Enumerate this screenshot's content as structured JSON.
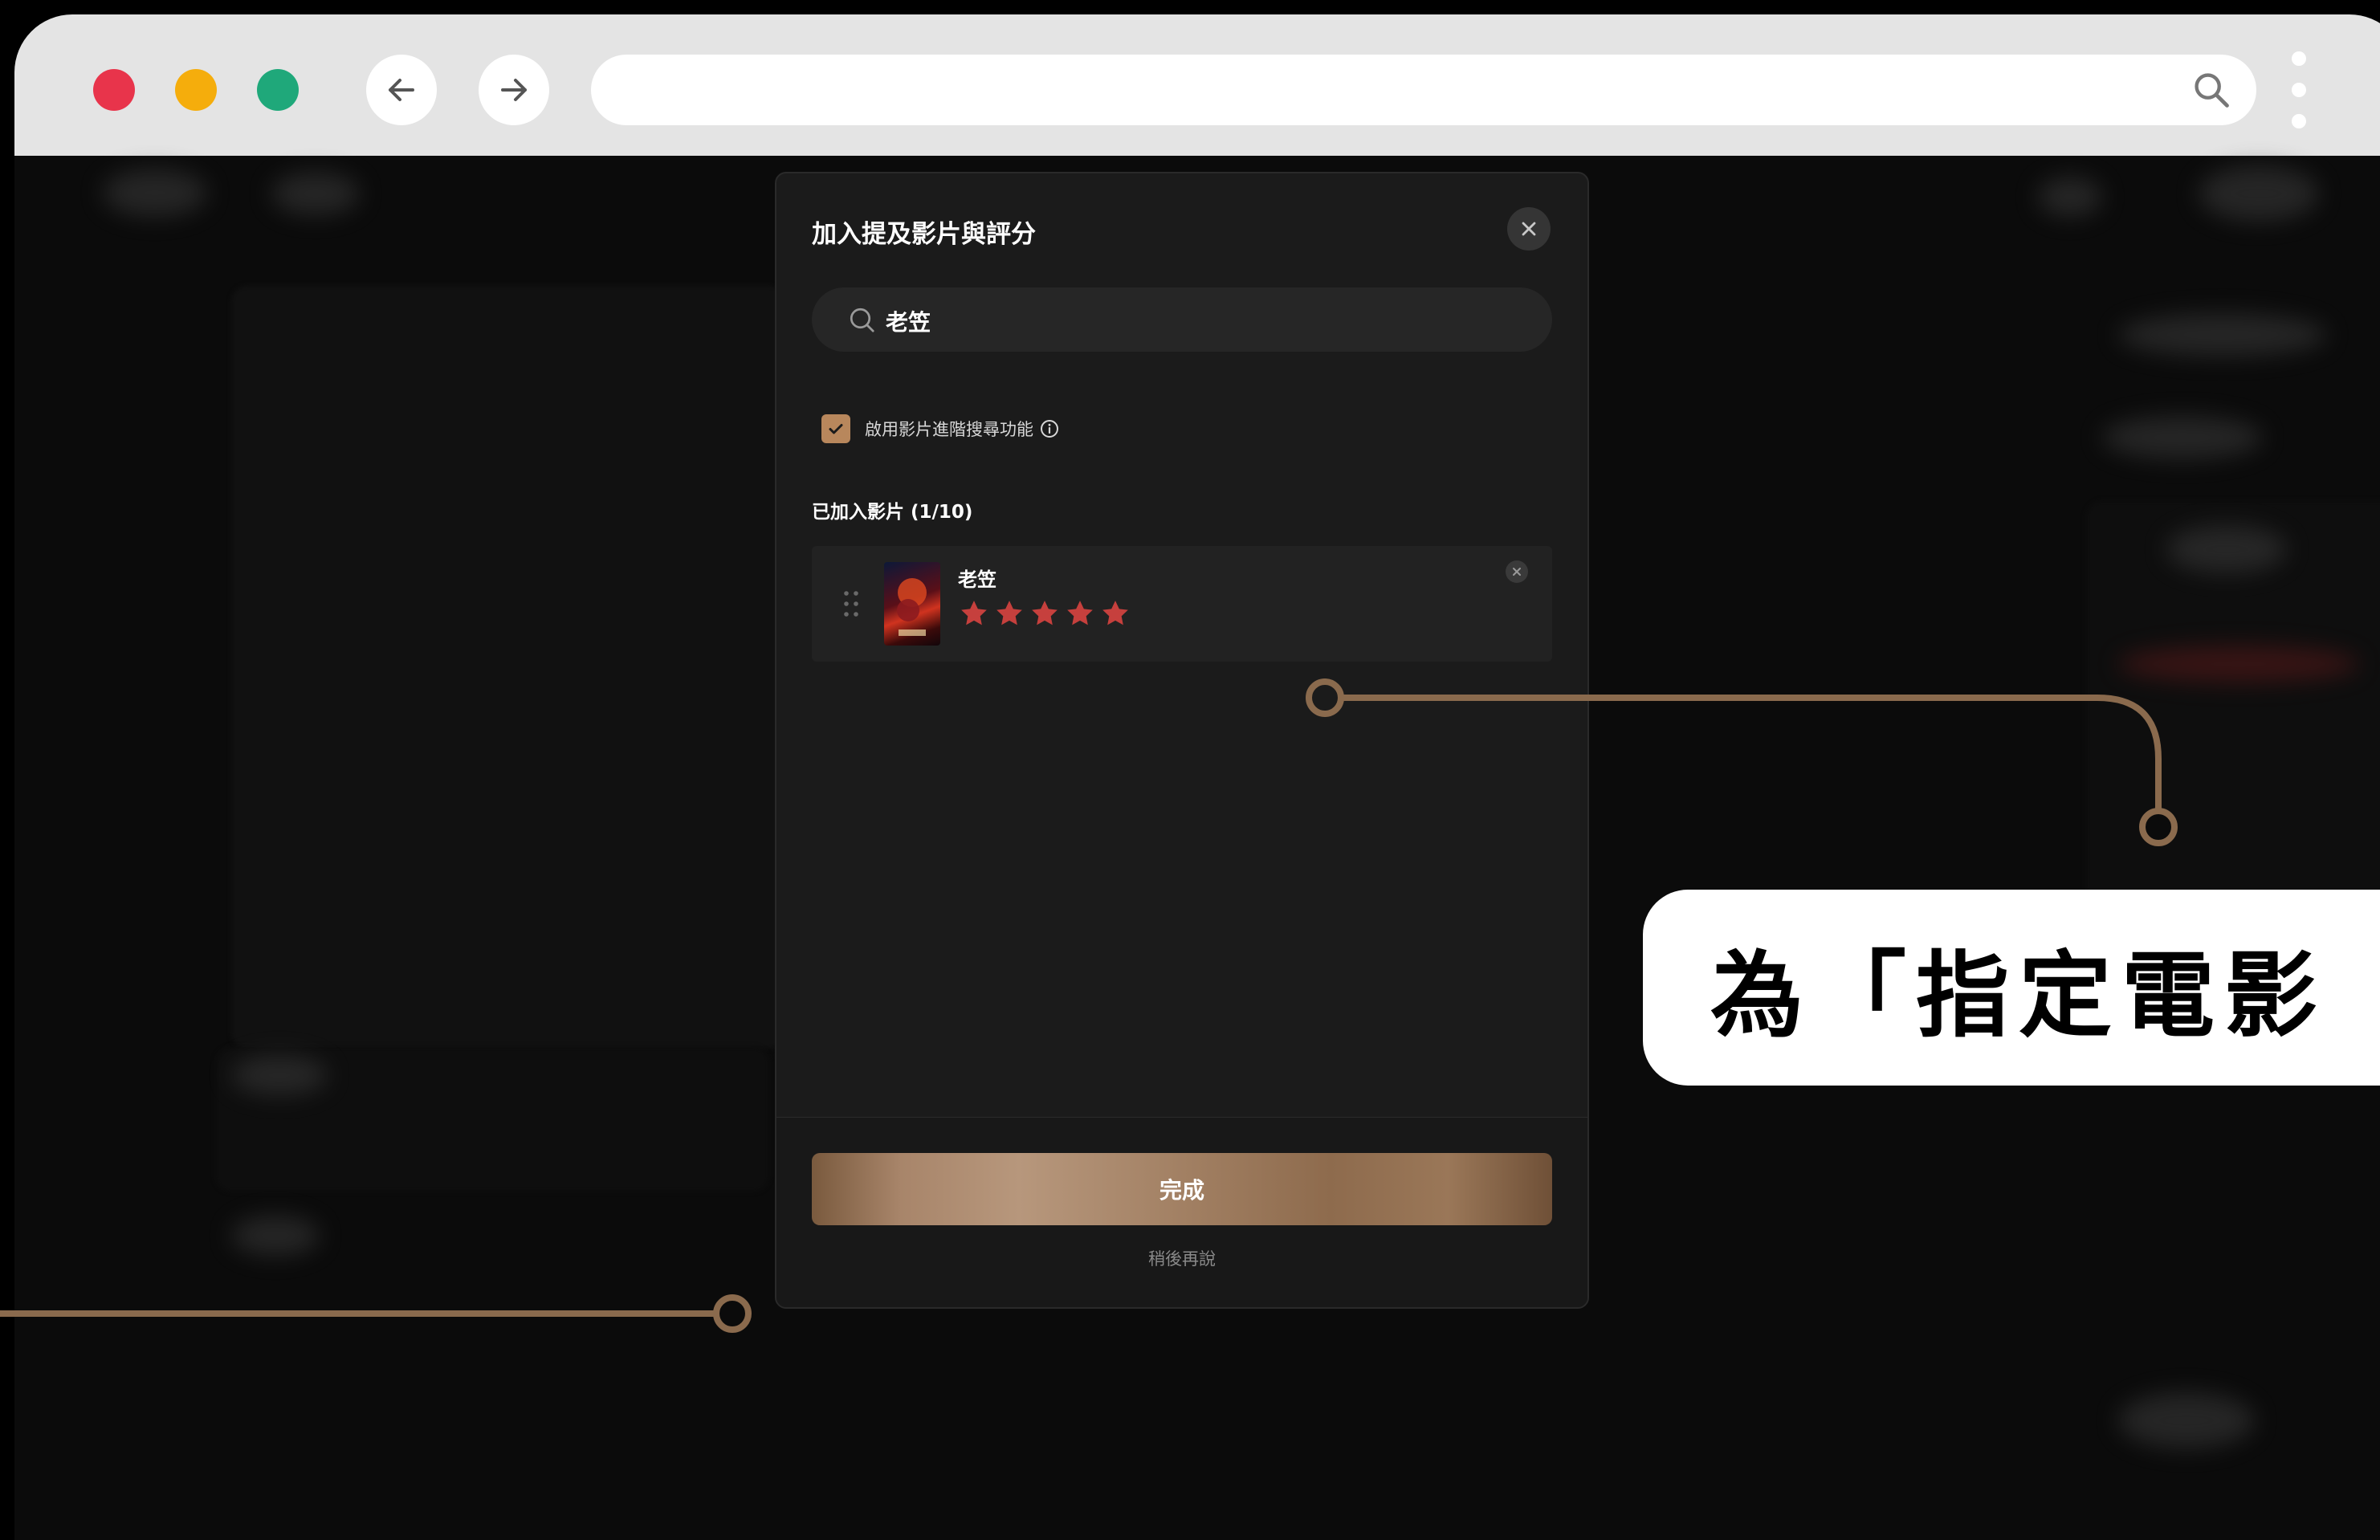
{
  "modal": {
    "title": "加入提及影片與評分",
    "search": {
      "value": "老笠"
    },
    "advanced_search": {
      "checked": true,
      "label": "啟用影片進階搜尋功能"
    },
    "added_label": "已加入影片 (1/10)",
    "movies": [
      {
        "title": "老笠",
        "rating": 5,
        "rating_max": 5
      }
    ],
    "done_label": "完成",
    "later_label": "稍後再說"
  },
  "callout": {
    "text": "為「指定電影"
  },
  "colors": {
    "accent": "#b8875c",
    "star": "#c6403d",
    "connector": "#8a6a4d",
    "dot_red": "#e8344b",
    "dot_yellow": "#f5ad0c",
    "dot_green": "#1fa87a"
  }
}
